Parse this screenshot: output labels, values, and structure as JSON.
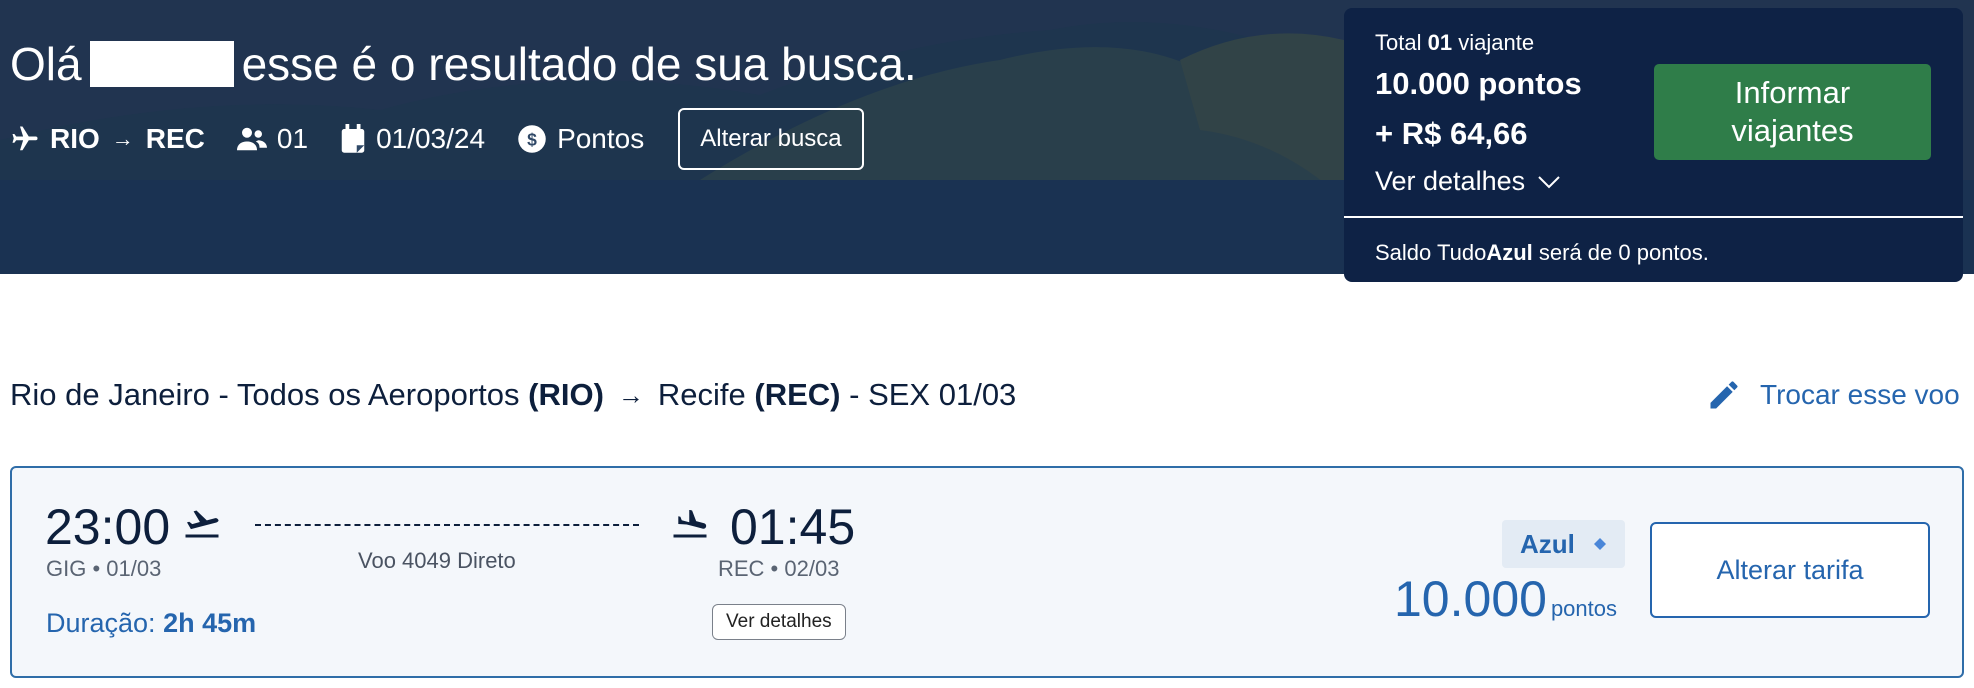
{
  "header": {
    "greeting_prefix": "Olá",
    "greeting_suffix": "esse é o resultado de sua busca."
  },
  "search_summary": {
    "origin": "RIO",
    "destination": "REC",
    "passengers": "01",
    "date": "01/03/24",
    "payment_type": "Pontos",
    "alter_search_label": "Alterar busca"
  },
  "booking_panel": {
    "total_label": "Total",
    "total_count": "01",
    "total_unit": "viajante",
    "points": "10.000 pontos",
    "money": "+ R$ 64,66",
    "details_label": "Ver detalhes",
    "cta_label_line1": "Informar",
    "cta_label_line2": "viajantes",
    "saldo_prefix": "Saldo Tudo",
    "saldo_brand": "Azul",
    "saldo_suffix": "será de 0 pontos."
  },
  "route": {
    "origin_city": "Rio de Janeiro - Todos os Aeroportos",
    "origin_code": "(RIO)",
    "destination_city": "Recife",
    "destination_code": "(REC)",
    "date_suffix": "- SEX 01/03",
    "swap_label": "Trocar esse voo"
  },
  "flight": {
    "departure_time": "23:00",
    "departure_info": "GIG • 01/03",
    "flight_label": "Voo 4049 Direto",
    "arrival_time": "01:45",
    "arrival_info": "REC • 02/03",
    "duration_label": "Duração:",
    "duration_value": "2h 45m",
    "details_label": "Ver detalhes",
    "fare_brand": "Azul",
    "price": "10.000",
    "price_unit": "pontos",
    "alter_fare_label": "Alterar tarifa"
  },
  "colors": {
    "panel_bg": "#0e2245",
    "cta_green": "#2f7d49",
    "accent_blue": "#2565ae"
  },
  "icons": [
    "plane-icon",
    "arrow-right-icon",
    "users-icon",
    "calendar-icon",
    "dollar-coin-icon",
    "chevron-down-icon",
    "pencil-icon",
    "takeoff-icon",
    "landing-icon",
    "diamond-icon"
  ]
}
